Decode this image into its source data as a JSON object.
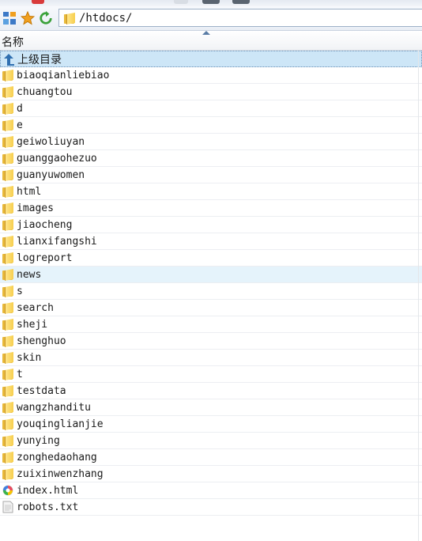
{
  "address_bar": {
    "path": "/htdocs/"
  },
  "columns": {
    "name_header": "名称",
    "sort": "ascending"
  },
  "parent_dir": {
    "label": "上级目录",
    "icon": "up-arrow-icon"
  },
  "files": [
    {
      "name": "biaoqianliebiao",
      "type": "folder"
    },
    {
      "name": "chuangtou",
      "type": "folder"
    },
    {
      "name": "d",
      "type": "folder"
    },
    {
      "name": "e",
      "type": "folder"
    },
    {
      "name": "geiwoliuyan",
      "type": "folder"
    },
    {
      "name": "guanggaohezuo",
      "type": "folder"
    },
    {
      "name": "guanyuwomen",
      "type": "folder"
    },
    {
      "name": "html",
      "type": "folder"
    },
    {
      "name": "images",
      "type": "folder"
    },
    {
      "name": "jiaocheng",
      "type": "folder"
    },
    {
      "name": "lianxifangshi",
      "type": "folder"
    },
    {
      "name": "logreport",
      "type": "folder"
    },
    {
      "name": "news",
      "type": "folder",
      "hover": true
    },
    {
      "name": "s",
      "type": "folder"
    },
    {
      "name": "search",
      "type": "folder"
    },
    {
      "name": "sheji",
      "type": "folder"
    },
    {
      "name": "shenghuo",
      "type": "folder"
    },
    {
      "name": "skin",
      "type": "folder"
    },
    {
      "name": "t",
      "type": "folder"
    },
    {
      "name": "testdata",
      "type": "folder"
    },
    {
      "name": "wangzhanditu",
      "type": "folder"
    },
    {
      "name": "youqinglianjie",
      "type": "folder"
    },
    {
      "name": "yunying",
      "type": "folder"
    },
    {
      "name": "zonghedaohang",
      "type": "folder"
    },
    {
      "name": "zuixinwenzhang",
      "type": "folder"
    },
    {
      "name": "index.html",
      "type": "html"
    },
    {
      "name": "robots.txt",
      "type": "text"
    }
  ],
  "colors": {
    "folder": "#f2c94c",
    "selection": "#cde6f7",
    "hover": "#e5f3fb",
    "refresh": "#3aa13a",
    "star": "#f0a020"
  }
}
